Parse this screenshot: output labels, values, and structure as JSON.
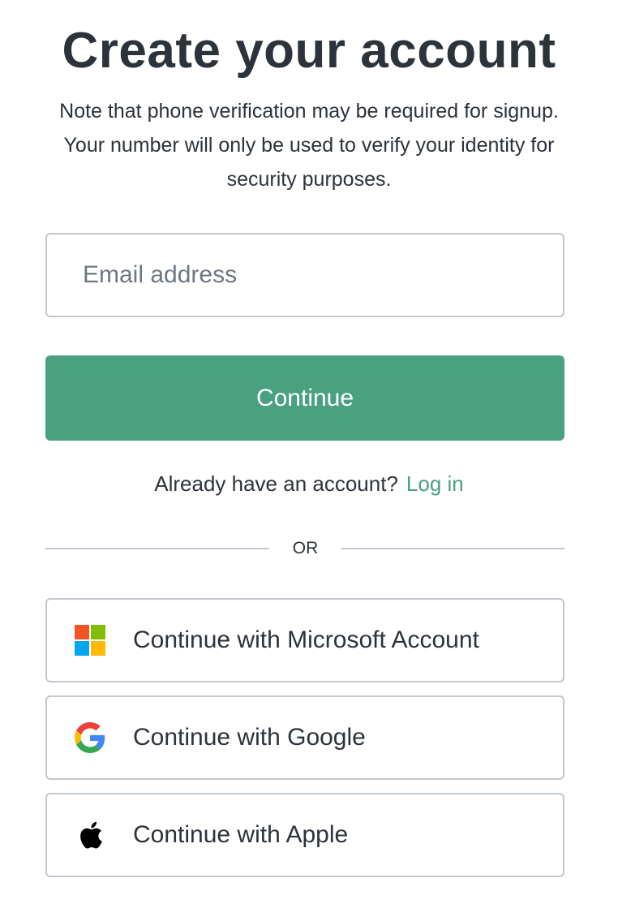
{
  "header": {
    "title": "Create your account",
    "subtitle": "Note that phone verification may be required for signup. Your number will only be used to verify your identity for security purposes."
  },
  "form": {
    "email_placeholder": "Email address",
    "email_value": "",
    "continue_label": "Continue"
  },
  "login": {
    "prompt": "Already have an account?",
    "link_label": "Log in"
  },
  "divider": {
    "text": "OR"
  },
  "social": [
    {
      "label": "Continue with Microsoft Account",
      "icon": "microsoft-icon"
    },
    {
      "label": "Continue with Google",
      "icon": "google-icon"
    },
    {
      "label": "Continue with Apple",
      "icon": "apple-icon"
    }
  ],
  "colors": {
    "accent": "#4aa181",
    "text": "#2d333a",
    "border": "#c2c8d0",
    "placeholder": "#6f7780"
  }
}
